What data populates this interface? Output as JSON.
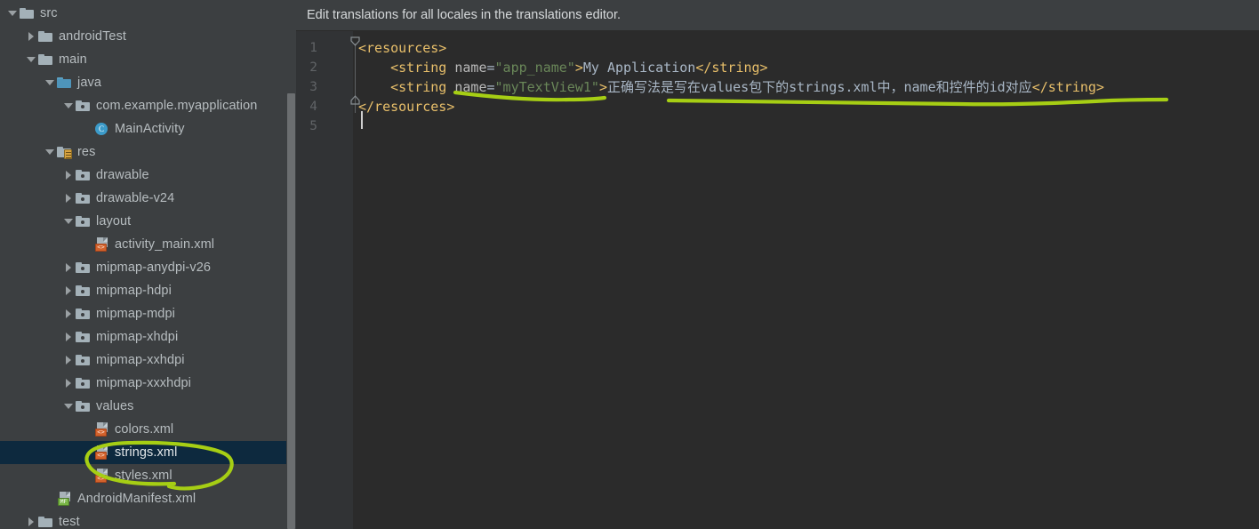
{
  "window": {
    "background": "#3c3f41",
    "editor_background": "#2b2b2b",
    "selection_color": "#0d293e",
    "annotation_color": "#a6ce14"
  },
  "notification": {
    "message": "Edit translations for all locales in the translations editor."
  },
  "project_tree": [
    {
      "label": "src",
      "indent": 0,
      "toggle": "down",
      "icon": "folder",
      "selected": false
    },
    {
      "label": "androidTest",
      "indent": 1,
      "toggle": "right",
      "icon": "folder",
      "selected": false
    },
    {
      "label": "main",
      "indent": 1,
      "toggle": "down",
      "icon": "folder",
      "selected": false
    },
    {
      "label": "java",
      "indent": 2,
      "toggle": "down",
      "icon": "folder-blue",
      "selected": false
    },
    {
      "label": "com.example.myapplication",
      "indent": 3,
      "toggle": "down",
      "icon": "folder-dot",
      "selected": false
    },
    {
      "label": "MainActivity",
      "indent": 4,
      "toggle": "none",
      "icon": "java-class",
      "selected": false
    },
    {
      "label": "res",
      "indent": 2,
      "toggle": "down",
      "icon": "folder-res",
      "selected": false
    },
    {
      "label": "drawable",
      "indent": 3,
      "toggle": "right",
      "icon": "folder-dot",
      "selected": false
    },
    {
      "label": "drawable-v24",
      "indent": 3,
      "toggle": "right",
      "icon": "folder-dot",
      "selected": false
    },
    {
      "label": "layout",
      "indent": 3,
      "toggle": "down",
      "icon": "folder-dot",
      "selected": false
    },
    {
      "label": "activity_main.xml",
      "indent": 4,
      "toggle": "none",
      "icon": "xml-file",
      "selected": false
    },
    {
      "label": "mipmap-anydpi-v26",
      "indent": 3,
      "toggle": "right",
      "icon": "folder-dot",
      "selected": false
    },
    {
      "label": "mipmap-hdpi",
      "indent": 3,
      "toggle": "right",
      "icon": "folder-dot",
      "selected": false
    },
    {
      "label": "mipmap-mdpi",
      "indent": 3,
      "toggle": "right",
      "icon": "folder-dot",
      "selected": false
    },
    {
      "label": "mipmap-xhdpi",
      "indent": 3,
      "toggle": "right",
      "icon": "folder-dot",
      "selected": false
    },
    {
      "label": "mipmap-xxhdpi",
      "indent": 3,
      "toggle": "right",
      "icon": "folder-dot",
      "selected": false
    },
    {
      "label": "mipmap-xxxhdpi",
      "indent": 3,
      "toggle": "right",
      "icon": "folder-dot",
      "selected": false
    },
    {
      "label": "values",
      "indent": 3,
      "toggle": "down",
      "icon": "folder-dot",
      "selected": false
    },
    {
      "label": "colors.xml",
      "indent": 4,
      "toggle": "none",
      "icon": "xml-file",
      "selected": false
    },
    {
      "label": "strings.xml",
      "indent": 4,
      "toggle": "none",
      "icon": "xml-file",
      "selected": true
    },
    {
      "label": "styles.xml",
      "indent": 4,
      "toggle": "none",
      "icon": "xml-file",
      "selected": false
    },
    {
      "label": "AndroidManifest.xml",
      "indent": 2,
      "toggle": "none",
      "icon": "manifest-file",
      "selected": false
    },
    {
      "label": "test",
      "indent": 1,
      "toggle": "right",
      "icon": "folder",
      "selected": false
    }
  ],
  "icon_badges": {
    "java_class": "C",
    "xml_badge": "<>",
    "manifest_badge": "MF"
  },
  "editor": {
    "line_numbers": [
      "1",
      "2",
      "3",
      "4",
      "5"
    ],
    "lines": [
      {
        "n": "1",
        "tokens": [
          {
            "t": "<resources>",
            "c": "tag"
          }
        ]
      },
      {
        "n": "2",
        "tokens": [
          {
            "t": "    ",
            "c": "punc"
          },
          {
            "t": "<string",
            "c": "tag"
          },
          {
            "t": " ",
            "c": "punc"
          },
          {
            "t": "name",
            "c": "attr"
          },
          {
            "t": "=",
            "c": "eq"
          },
          {
            "t": "\"app_name\"",
            "c": "str"
          },
          {
            "t": ">",
            "c": "tag"
          },
          {
            "t": "My Application",
            "c": "val"
          },
          {
            "t": "</string>",
            "c": "tag"
          }
        ]
      },
      {
        "n": "3",
        "tokens": [
          {
            "t": "    ",
            "c": "punc"
          },
          {
            "t": "<string",
            "c": "tag"
          },
          {
            "t": " ",
            "c": "punc"
          },
          {
            "t": "name",
            "c": "attr"
          },
          {
            "t": "=",
            "c": "eq"
          },
          {
            "t": "\"myTextView1\"",
            "c": "str"
          },
          {
            "t": ">",
            "c": "tag"
          },
          {
            "t": "正确写法是写在values包下的strings.xml中，name和控件的id对应",
            "c": "val"
          },
          {
            "t": "</string>",
            "c": "tag"
          }
        ]
      },
      {
        "n": "4",
        "tokens": [
          {
            "t": "</resources>",
            "c": "tag"
          }
        ]
      },
      {
        "n": "5",
        "tokens": []
      }
    ],
    "caret_line": 5
  },
  "annotations": [
    {
      "name": "underline-name-attribute",
      "type": "underline"
    },
    {
      "name": "underline-chinese-string",
      "type": "underline"
    },
    {
      "name": "circle-strings-xml",
      "type": "ellipse"
    }
  ]
}
